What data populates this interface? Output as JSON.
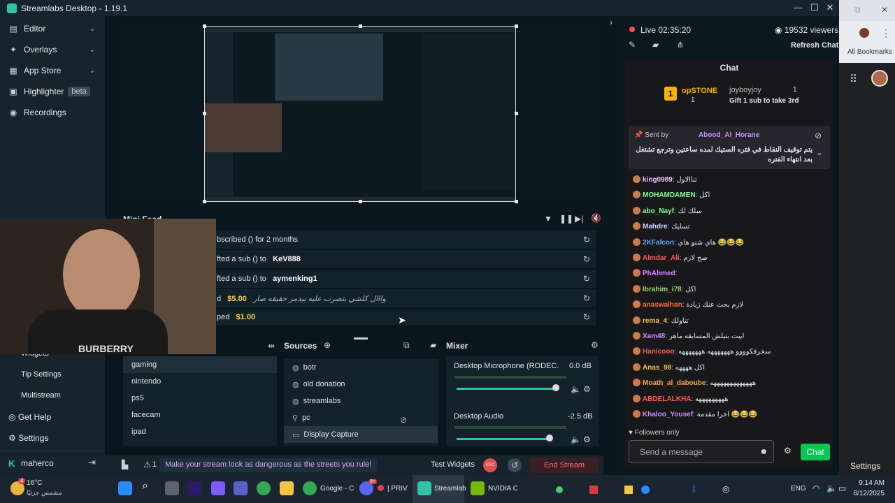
{
  "window": {
    "title": "Streamlabs Desktop - 1.19.1"
  },
  "sidebar": {
    "items": [
      {
        "label": "Editor",
        "icon": "editor-icon"
      },
      {
        "label": "Overlays",
        "icon": "overlays-icon"
      },
      {
        "label": "App Store",
        "icon": "app-store-icon"
      },
      {
        "label": "Highlighter",
        "icon": "highlighter-icon",
        "badge": "beta"
      },
      {
        "label": "Recordings",
        "icon": "recordings-icon"
      }
    ],
    "lower_items": [
      "Widgets",
      "Tip Settings",
      "Multistream"
    ],
    "get_help": "Get Help",
    "settings": "Settings",
    "user": "maherco"
  },
  "minifeed": {
    "title": "Mini Feed",
    "rows": [
      {
        "text": "bscribed () for 2 months",
        "bold": ""
      },
      {
        "text": "fted a sub () to",
        "bold": "KeV888"
      },
      {
        "text": "fted a sub () to",
        "bold": "aymenking1"
      },
      {
        "text": "d",
        "bold": "$5.00",
        "extra": "وااال كلشي بتضرب عليه بيدمر حقيقه صار"
      },
      {
        "text": "ped",
        "bold": "$1.00",
        "extra": ""
      }
    ]
  },
  "webcam": {
    "shirt_text": "BURBERRY"
  },
  "scenes": {
    "items": [
      "gaming",
      "nintendo",
      "ps5",
      "facecam",
      "ipad"
    ],
    "selected": "gaming"
  },
  "sources": {
    "title": "Sources",
    "items": [
      "botr",
      "old donation",
      "streamlabs",
      "pc",
      "Display Capture"
    ]
  },
  "mixer": {
    "title": "Mixer",
    "channels": [
      {
        "name": "Desktop Microphone (RODEC...",
        "db": "0.0 dB",
        "level": 0.73
      },
      {
        "name": "Desktop Audio",
        "db": "-2.5 dB",
        "level": 0.68
      }
    ]
  },
  "bottombar": {
    "alert_count": "1",
    "alert_text": "Make your stream look as dangerous as the streets you rule!",
    "test_widgets": "Test Widgets",
    "rec": "REC",
    "end_stream": "End Stream"
  },
  "stream": {
    "live": "Live",
    "time": "02:35:20",
    "viewers": "19532 viewers",
    "refresh": "Refresh Chat"
  },
  "chat": {
    "title": "Chat",
    "topgift": {
      "rank": "1",
      "user1": "opSTONE",
      "count1": "1",
      "user2": "joyboyjoy",
      "count2": "1",
      "gift_text": "Gift 1 sub to take 3rd"
    },
    "pinned": {
      "sent_by": "Sent by",
      "user": "Abood_Al_Horane",
      "message": "يتم توقيف النقاط في فتره الستيك لمده ساعتين وترجع تشتغل بعد انتهاء الفتره"
    },
    "messages": [
      {
        "user": "king0989",
        "msg": "تناالاول",
        "color": "#e8c2ff"
      },
      {
        "user": "MOHAMDAMEN",
        "msg": "اكل",
        "color": "#7dff9a"
      },
      {
        "user": "abo_Nayf",
        "msg": "سلك لك",
        "color": "#7dff9a"
      },
      {
        "user": "Mahdre",
        "msg": "تسليك",
        "color": "#c9d6ff"
      },
      {
        "user": "2KFalcon",
        "msg": "هاي شنو هاي 😂😂😂",
        "color": "#5fa8ff"
      },
      {
        "user": "Almdar_Ali",
        "msg": "صح لازم",
        "color": "#ff5a5a"
      },
      {
        "user": "PhAhmed",
        "msg": "",
        "color": "#d38cff"
      },
      {
        "user": "Ibrahim_i78",
        "msg": "اكل",
        "color": "#9bd66a"
      },
      {
        "user": "anaswalhan",
        "msg": "لازم بحث عنك زيادة",
        "color": "#ff6a3a"
      },
      {
        "user": "rema_4",
        "msg": "تناولك",
        "color": "#f5c542"
      },
      {
        "user": "Xam48",
        "msg": "ايبت بتيلش المسابقه ماهر",
        "color": "#d38cff"
      },
      {
        "user": "Hanicooo",
        "msg": "سخرفكوووو هههههههه هههههههه",
        "color": "#ff5a5a"
      },
      {
        "user": "Anas_98",
        "msg": "اكل ههههه",
        "color": "#f5c542"
      },
      {
        "user": "Moath_al_daboube",
        "msg": "هههههههههههههه",
        "color": "#f5a742"
      },
      {
        "user": "ABDELALKHA",
        "msg": "هههههههههه",
        "color": "#ff5a5a"
      },
      {
        "user": "Khaloo_Yousef",
        "msg": "اخرا مقدمة 😂😂😂",
        "color": "#d38cff"
      }
    ],
    "followers_only": "Followers only",
    "placeholder": "Send a message",
    "send": "Chat"
  },
  "browser": {
    "bookmarks": "All Bookmarks",
    "settings": "Settings"
  },
  "taskbar": {
    "temp": "16°C",
    "weather": "مشمس جزئيًا",
    "badge": "4",
    "apps": [
      "Google - C",
      "| PRIV.",
      "Streamlab",
      "NVIDIA C"
    ],
    "discord_badge": "9+",
    "lang": "ENG",
    "time": "9:14 AM",
    "date": "8/12/2025"
  }
}
